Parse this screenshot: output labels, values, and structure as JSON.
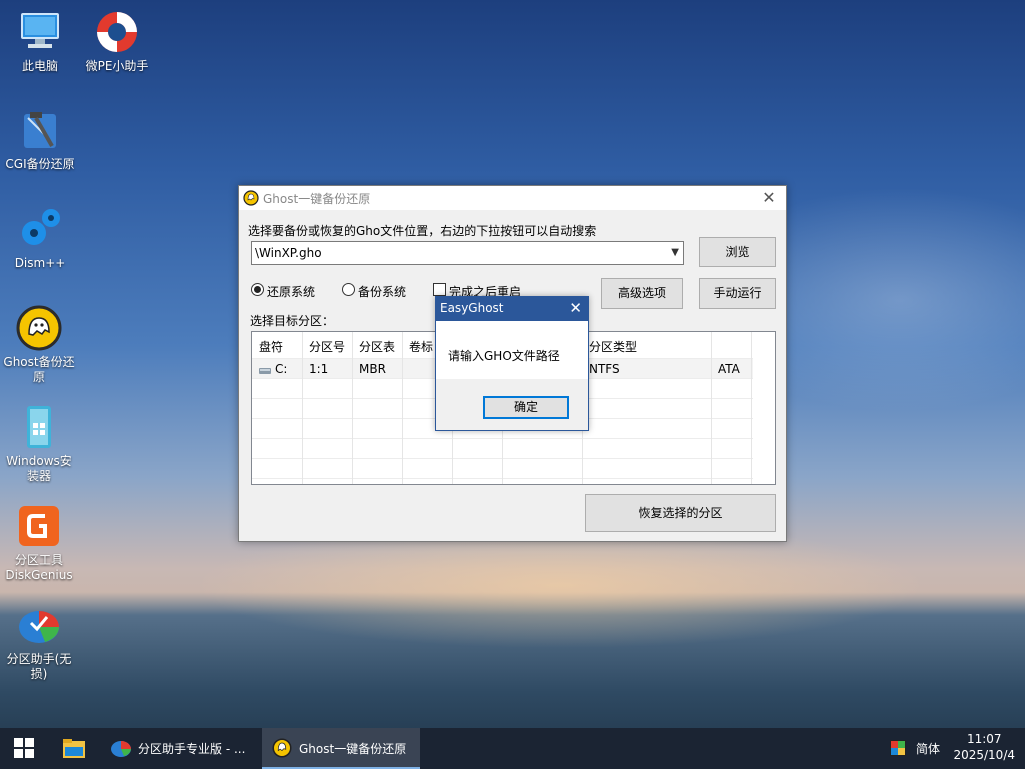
{
  "desktop": {
    "icons": [
      {
        "label": "此电脑",
        "icon": "computer-icon"
      },
      {
        "label": "微PE小助手",
        "icon": "lifebuoy-icon"
      },
      {
        "label": "CGI备份还原",
        "icon": "hammer-icon"
      },
      {
        "label": "Dism++",
        "icon": "gear-icon"
      },
      {
        "label": "Ghost备份还原",
        "icon": "ghost-icon"
      },
      {
        "label": "Windows安装器",
        "icon": "windows-installer-icon"
      },
      {
        "label": "分区工具DiskGenius",
        "icon": "diskgenius-icon"
      },
      {
        "label": "分区助手(无损)",
        "icon": "partition-assistant-icon"
      }
    ],
    "icon_labels_wrapped": {
      "pc": "此电脑",
      "pe": "微PE小助手",
      "cgi": "CGI备份还原",
      "dism": "Dism++",
      "ghost_1": "Ghost备份还",
      "ghost_2": "原",
      "win_1": "Windows安",
      "win_2": "装器",
      "dg_1": "分区工具",
      "dg_2": "DiskGenius",
      "pa_1": "分区助手(无",
      "pa_2": "损)"
    }
  },
  "window": {
    "title": "Ghost一键备份还原",
    "instruction": "选择要备份或恢复的Gho文件位置，右边的下拉按钮可以自动搜索",
    "path_value": "\\WinXP.gho",
    "browse_label": "浏览",
    "radio_restore": "还原系统",
    "radio_backup": "备份系统",
    "restore_selected": true,
    "checkbox_restart": "完成之后重启",
    "restart_checked": false,
    "advanced_label": "高级选项",
    "manual_label": "手动运行",
    "target_label": "选择目标分区：",
    "table": {
      "columns": [
        "盘符",
        "分区号",
        "分区表",
        "卷标",
        "",
        "",
        "分区类型",
        ""
      ],
      "rows": [
        {
          "drive": "C:",
          "partition": "1:1",
          "table": "MBR",
          "label": "",
          "fs": "NTFS",
          "type": "ATA"
        }
      ]
    },
    "action_label": "恢复选择的分区"
  },
  "dialog": {
    "title": "EasyGhost",
    "message": "请输入GHO文件路径",
    "ok_label": "确定"
  },
  "taskbar": {
    "items": [
      {
        "label": "分区助手专业版 - ..."
      },
      {
        "label": "Ghost一键备份还原",
        "active": true
      }
    ],
    "ime": "简体",
    "time": "11:07",
    "date": "2025/10/4"
  },
  "colors": {
    "dialog_accent": "#2b579a",
    "taskbar": "#1b2433"
  }
}
